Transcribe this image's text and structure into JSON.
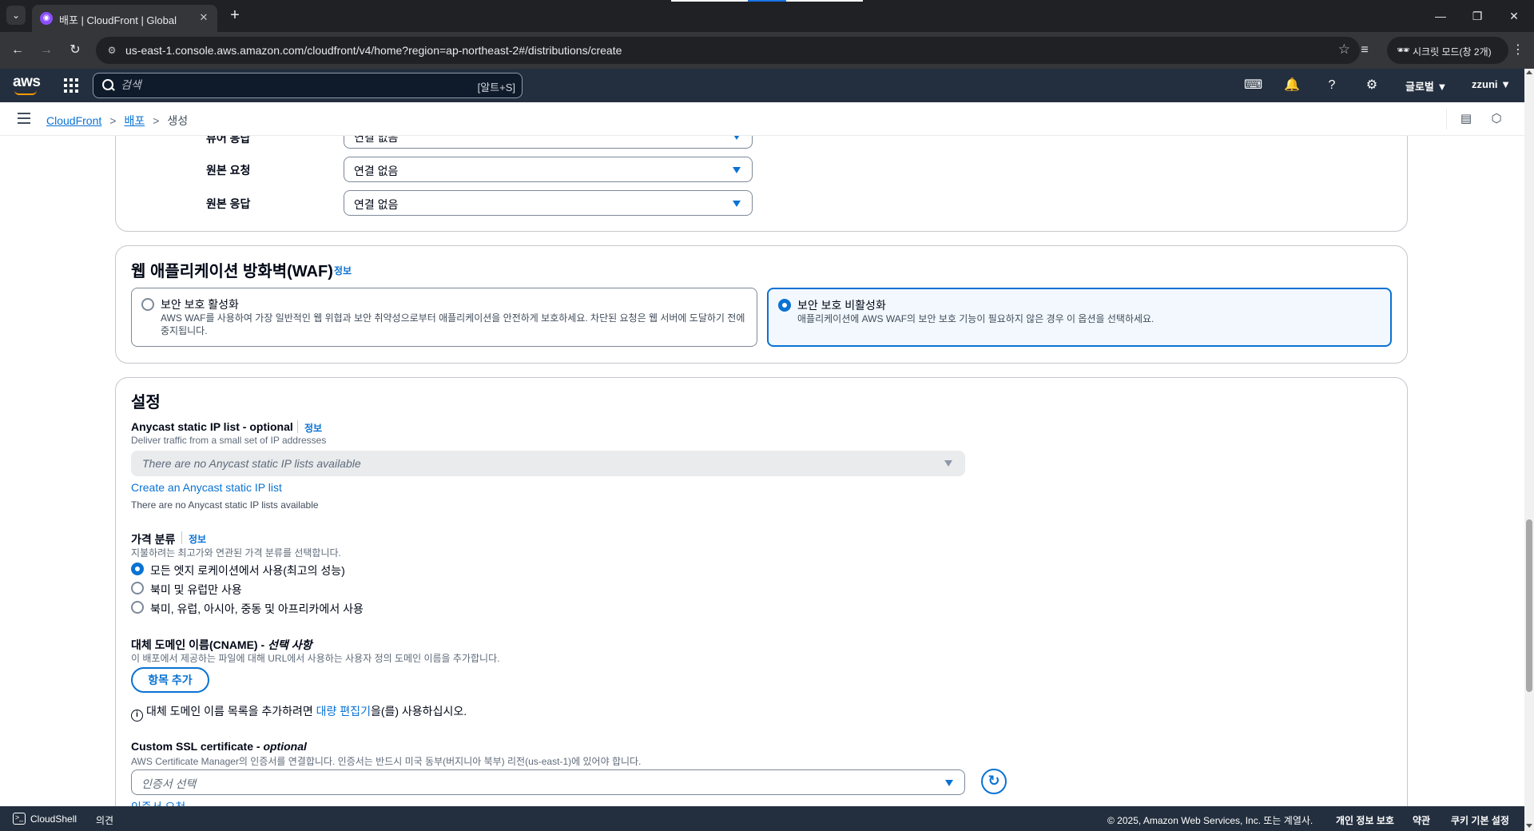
{
  "browser": {
    "tab_title": "배포 | CloudFront | Global",
    "url": "us-east-1.console.aws.amazon.com/cloudfront/v4/home?region=ap-northeast-2#/distributions/create",
    "incognito_label": "시크릿 모드(창 2개)"
  },
  "aws_header": {
    "search_placeholder": "검색",
    "search_shortcut": "[알트+S]",
    "region": "글로벌 ▼",
    "user": "zzuni ▼"
  },
  "breadcrumb": {
    "items": [
      "CloudFront",
      "배포"
    ],
    "current": "생성"
  },
  "function_assoc": {
    "rows": [
      {
        "label": "뷰어 응답",
        "value": "연결 없음"
      },
      {
        "label": "원본 요청",
        "value": "연결 없음"
      },
      {
        "label": "원본 응답",
        "value": "연결 없음"
      }
    ]
  },
  "waf": {
    "title": "웹 애플리케이션 방화벽(WAF)",
    "info": "정보",
    "options": [
      {
        "title": "보안 보호 활성화",
        "desc_line1": "AWS WAF를 사용하여 가장 일반적인 웹 위협과 보안 취약성으로부터 애플리케이션을 안전하게 보호하세요. 차단된 요청은 웹 서버에 도달하기 전에",
        "desc_line2": "중지됩니다.",
        "selected": false
      },
      {
        "title": "보안 보호 비활성화",
        "desc_line1": "애플리케이션에 AWS WAF의 보안 보호 기능이 필요하지 않은 경우 이 옵션을 선택하세요.",
        "desc_line2": "",
        "selected": true
      }
    ]
  },
  "settings": {
    "title": "설정",
    "anycast": {
      "label": "Anycast static IP list - optional",
      "info": "정보",
      "desc": "Deliver traffic from a small set of IP addresses",
      "select_value": "There are no Anycast static IP lists available",
      "create_link": "Create an Anycast static IP list",
      "note": "There are no Anycast static IP lists available"
    },
    "price_class": {
      "label": "가격 분류",
      "info": "정보",
      "desc": "지불하려는 최고가와 연관된 가격 분류를 선택합니다.",
      "options": [
        {
          "label": "모든 엣지 로케이션에서 사용(최고의 성능)",
          "selected": true
        },
        {
          "label": "북미 및 유럽만 사용",
          "selected": false
        },
        {
          "label": "북미, 유럽, 아시아, 중동 및 아프리카에서 사용",
          "selected": false
        }
      ]
    },
    "cname": {
      "label": "대체 도메인 이름(CNAME) - ",
      "label_italic": "선택 사항",
      "desc": "이 배포에서 제공하는 파일에 대해 URL에서 사용하는 사용자 정의 도메인 이름을 추가합니다.",
      "add_button": "항목 추가",
      "note_prefix": "대체 도메인 이름 목록을 추가하려면 ",
      "note_link": "대량 편집기",
      "note_suffix": "을(를) 사용하십시오."
    },
    "ssl": {
      "label": "Custom SSL certificate - ",
      "label_italic": "optional",
      "desc": "AWS Certificate Manager의 인증서를 연결합니다. 인증서는 반드시 미국 동부(버지니아 북부) 리전(us-east-1)에 있어야 합니다.",
      "placeholder": "인증서 선택",
      "request_link": "인증서 요청"
    }
  },
  "footer": {
    "cloudshell": "CloudShell",
    "feedback": "의견",
    "copyright": "© 2025, Amazon Web Services, Inc. 또는 계열사.",
    "privacy": "개인 정보 보호",
    "terms": "약관",
    "cookies": "쿠키 기본 설정"
  }
}
